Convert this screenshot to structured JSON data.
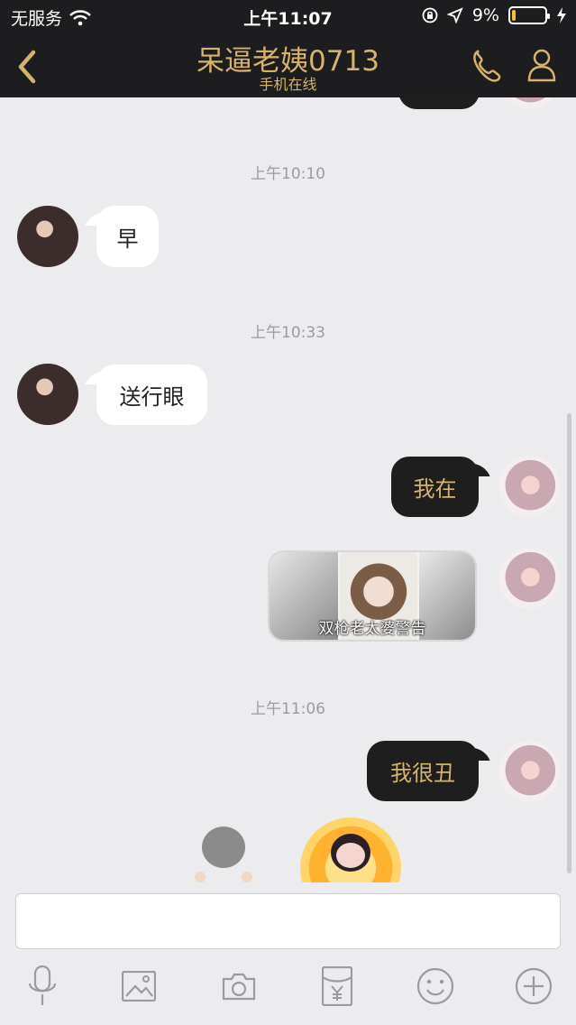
{
  "status": {
    "carrier": "无服务",
    "time": "上午11:07",
    "battery": "9%"
  },
  "header": {
    "title": "呆逼老姨0713",
    "subtitle": "手机在线"
  },
  "messages": {
    "time1": "上午10:10",
    "msg1": "早",
    "time2": "上午10:33",
    "msg2": "送行眼",
    "msg3": "我在",
    "image_caption": "双枪老太婆警告",
    "time3": "上午11:06",
    "msg4": "我很丑"
  },
  "input": {
    "placeholder": ""
  },
  "icons": {
    "back": "chevron-left-icon",
    "call": "phone-icon",
    "contact": "contact-icon",
    "voice": "microphone-icon",
    "gallery": "image-icon",
    "camera": "camera-icon",
    "red_packet": "red-packet-icon",
    "emoji": "emoji-icon",
    "more": "plus-icon"
  },
  "colors": {
    "header_bg": "#1d1d1f",
    "accent_gold": "#d7b36a",
    "chat_bg": "#ececef"
  }
}
